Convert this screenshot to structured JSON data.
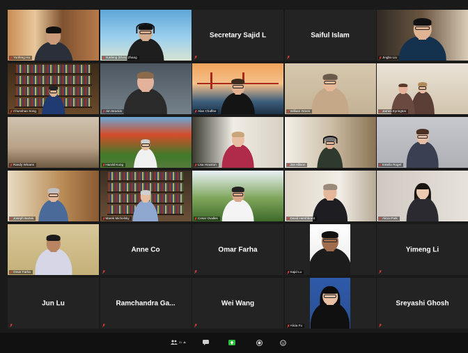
{
  "app": {
    "name": "Zoom Meeting",
    "view": "Gallery View"
  },
  "participants": [
    {
      "name": "Yunfeng Hu",
      "display": "video",
      "muted": true
    },
    {
      "name": "Yunfeng (Elvis) Zhang",
      "display": "video",
      "muted": true
    },
    {
      "name": "Secretary Sajid L",
      "display": "name",
      "muted": true
    },
    {
      "name": "Saiful Islam",
      "display": "name",
      "muted": true
    },
    {
      "name": "Jingbo Liu",
      "display": "video",
      "muted": true
    },
    {
      "name": "Chunshan Song",
      "display": "video",
      "muted": true,
      "active_speaker": true
    },
    {
      "name": "Jim Brackin",
      "display": "video",
      "muted": true
    },
    {
      "name": "Alan Chaffee",
      "display": "video",
      "muted": true
    },
    {
      "name": "William Green",
      "display": "video",
      "muted": true
    },
    {
      "name": "James Eyrington",
      "display": "video",
      "muted": true
    },
    {
      "name": "Randy Winans",
      "display": "video",
      "muted": true
    },
    {
      "name": "Harold Kung",
      "display": "video",
      "muted": true
    },
    {
      "name": "Lisa Houston",
      "display": "video",
      "muted": true
    },
    {
      "name": "Joe Allison",
      "display": "video",
      "muted": true
    },
    {
      "name": "Estella Rogel",
      "display": "video",
      "muted": true
    },
    {
      "name": "Joseph Bartek",
      "display": "video",
      "muted": true
    },
    {
      "name": "Marek Michelsky",
      "display": "video",
      "muted": true
    },
    {
      "name": "Cesar Ovalles",
      "display": "video",
      "muted": true
    },
    {
      "name": "David Hershbrant",
      "display": "video",
      "muted": true
    },
    {
      "name": "Alicia Park",
      "display": "video",
      "muted": true
    },
    {
      "name": "Omar Farha",
      "display": "video",
      "muted": true
    },
    {
      "name": "Anne Co",
      "display": "name",
      "muted": true
    },
    {
      "name": "Omar Farha",
      "display": "name",
      "muted": true
    },
    {
      "name": "Sajid Lu",
      "display": "video",
      "muted": true
    },
    {
      "name": "Yimeng Li",
      "display": "name",
      "muted": true
    },
    {
      "name": "Jun Lu",
      "display": "name",
      "muted": true
    },
    {
      "name": "Ramchandra Ga...",
      "display": "name",
      "muted": true
    },
    {
      "name": "Wei Wang",
      "display": "name",
      "muted": true
    },
    {
      "name": "Alicia Fu",
      "display": "video",
      "muted": true
    },
    {
      "name": "Sreyashi Ghosh",
      "display": "name",
      "muted": true
    }
  ],
  "toolbar": {
    "participants_count": "31",
    "items": [
      {
        "icon": "participants-icon"
      },
      {
        "icon": "chat-icon"
      },
      {
        "icon": "share-screen-icon",
        "color": "#2bbd3b"
      },
      {
        "icon": "record-icon"
      },
      {
        "icon": "reactions-icon"
      }
    ]
  },
  "colors": {
    "background": "#1a1a1a",
    "tile": "#232323",
    "active_speaker_border": "#c9d400",
    "muted_icon": "#e0413a",
    "share_green": "#2bbd3b"
  }
}
